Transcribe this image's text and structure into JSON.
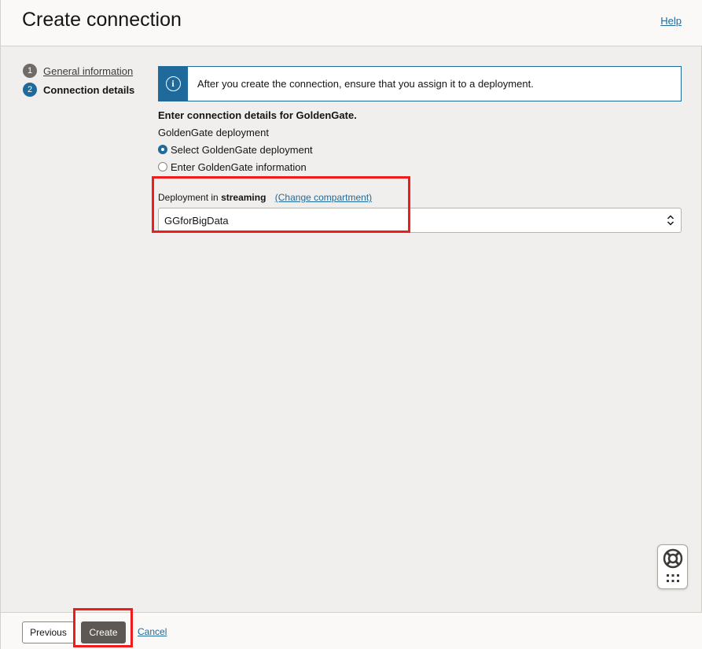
{
  "header": {
    "title": "Create connection",
    "help_label": "Help"
  },
  "steps": [
    {
      "number": "1",
      "label": "General information"
    },
    {
      "number": "2",
      "label": "Connection details"
    }
  ],
  "info": {
    "icon": "info-icon",
    "icon_glyph": "i",
    "message": "After you create the connection, ensure that you assign it to a deployment."
  },
  "form": {
    "section_heading": "Enter connection details for GoldenGate.",
    "deployment_group_label": "GoldenGate deployment",
    "options": [
      {
        "label": "Select GoldenGate deployment",
        "checked": true
      },
      {
        "label": "Enter GoldenGate information",
        "checked": false
      }
    ],
    "deployment_label_prefix": "Deployment in",
    "compartment": "streaming",
    "change_compartment_label": "(Change compartment)",
    "deployment_value": "GGforBigData"
  },
  "footer": {
    "previous_label": "Previous",
    "create_label": "Create",
    "cancel_label": "Cancel"
  },
  "colors": {
    "accent": "#1f6a9a",
    "highlight": "#ee1c1c",
    "primary_button": "#5d5853"
  }
}
